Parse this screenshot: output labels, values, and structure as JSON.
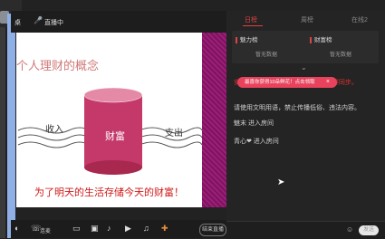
{
  "topbar": {
    "close_label": "桌",
    "live_label": "直播中"
  },
  "slide": {
    "title": "个人理财的概念",
    "income": "收入",
    "expense": "支出",
    "drum": "财富",
    "caption": "为了明天的生活存储今天的财富！"
  },
  "bottombar": {
    "lianmai_label": "连麦",
    "end_label": "结束直播"
  },
  "panel": {
    "tabs": [
      "日榜",
      "周榜",
      "在线2"
    ],
    "rank_left": {
      "title": "魅力榜",
      "empty": "暂无数据"
    },
    "rank_right": {
      "title": "财富榜",
      "empty": "暂无数据"
    },
    "messages": [
      "请使用文明用语，禁止传播低俗、违法内容。",
      "魅末 进入房间",
      "青心❤ 进入房间"
    ],
    "safety_tail": "安全、规视房间文字请勿私下与QQ群同步。",
    "toast": "最喜你获得10朵鲜花！点击领取",
    "send_label": "发送"
  }
}
